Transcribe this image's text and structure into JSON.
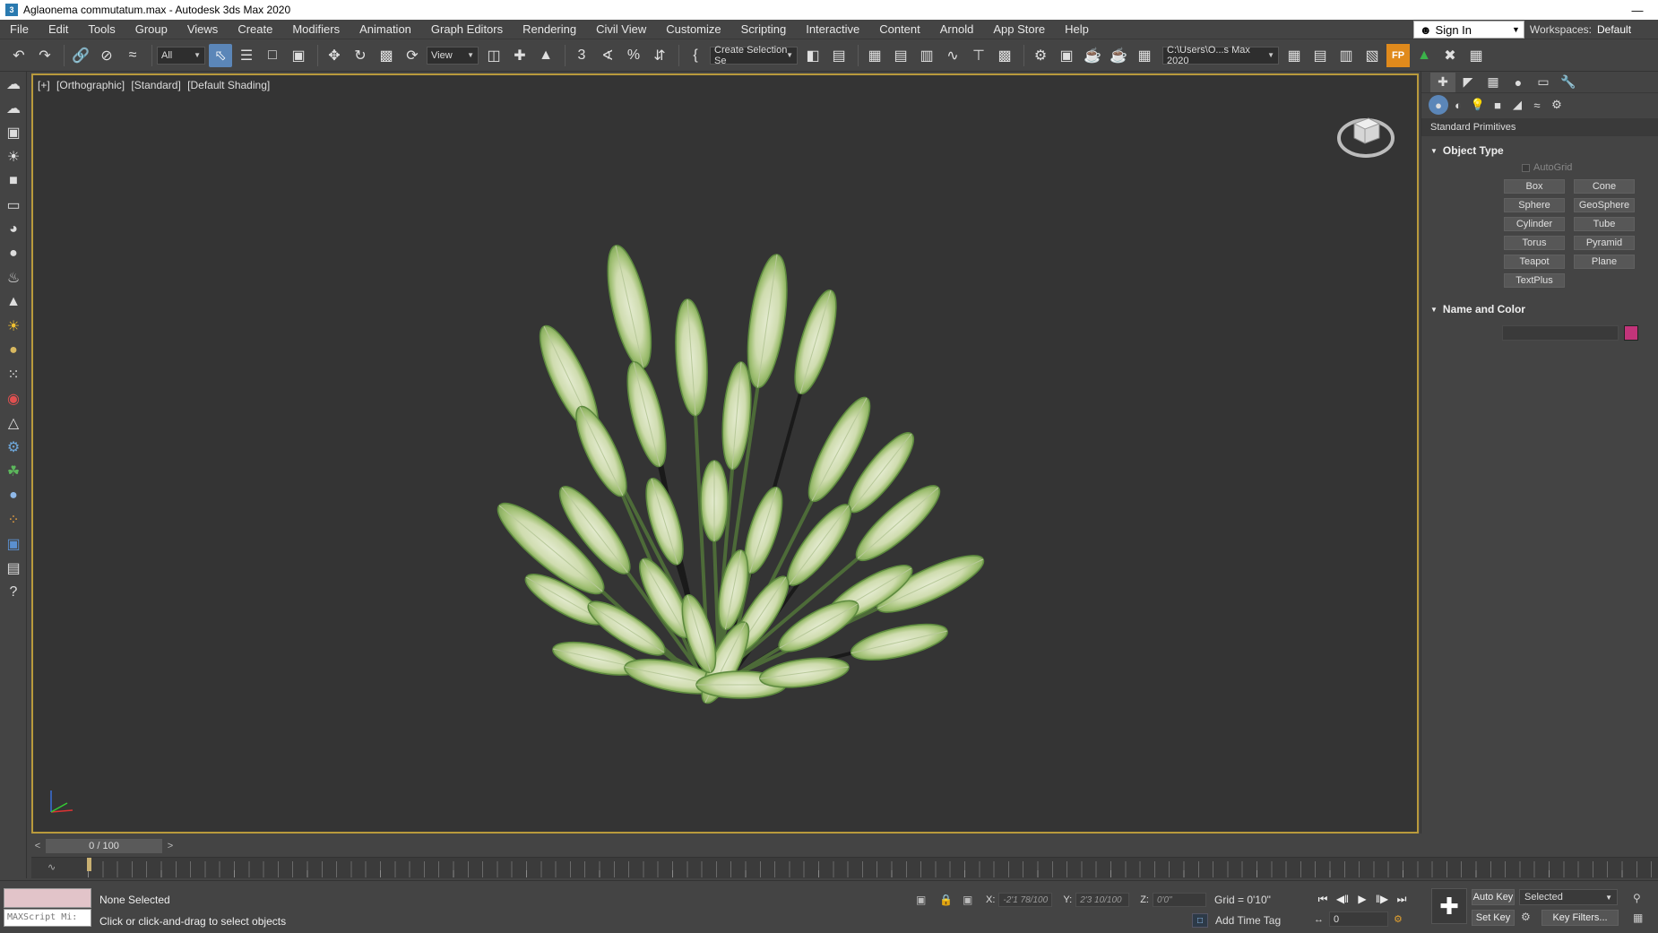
{
  "window": {
    "title": "Aglaonema commutatum.max - Autodesk 3ds Max 2020",
    "app_icon": "3"
  },
  "menu": [
    "File",
    "Edit",
    "Tools",
    "Group",
    "Views",
    "Create",
    "Modifiers",
    "Animation",
    "Graph Editors",
    "Rendering",
    "Civil View",
    "Customize",
    "Scripting",
    "Interactive",
    "Content",
    "Arnold",
    "App Store",
    "Help"
  ],
  "account": {
    "sign_in": "Sign In",
    "workspaces_label": "Workspaces:",
    "workspace_value": "Default"
  },
  "toolbar": {
    "filter_combo": "All",
    "ref_coord_combo": "View",
    "selection_set_combo": "Create Selection Se",
    "project_path": "C:\\Users\\O...s Max 2020"
  },
  "viewport": {
    "labels": [
      "[+]",
      "[Orthographic]",
      "[Standard]",
      "[Default Shading]"
    ],
    "viewcube_icon": "viewcube-icon",
    "accent_border": "#b99a3c"
  },
  "command_panel": {
    "category_dropdown": "Standard Primitives",
    "object_type_title": "Object Type",
    "autogrid_label": "AutoGrid",
    "primitives": [
      "Box",
      "Cone",
      "Sphere",
      "GeoSphere",
      "Cylinder",
      "Tube",
      "Torus",
      "Pyramid",
      "Teapot",
      "Plane",
      "TextPlus"
    ],
    "name_color_title": "Name and Color",
    "object_color": "#c2347a"
  },
  "timeline": {
    "frame_display": "0 / 100",
    "prev": "<",
    "next": ">"
  },
  "status": {
    "selection": "None Selected",
    "prompt": "Click or click-and-drag to select objects",
    "maxscript_placeholder": "MAXScript Mi:",
    "x_label": "X:",
    "x_value": "-2'1 78/100",
    "y_label": "Y:",
    "y_value": "2'3 10/100",
    "z_label": "Z:",
    "z_value": "0'0\"",
    "grid": "Grid = 0'10\"",
    "add_time_tag": "Add Time Tag",
    "auto_key": "Auto Key",
    "set_key": "Set Key",
    "key_mode": "Selected",
    "key_filters": "Key Filters...",
    "current_frame": "0"
  }
}
